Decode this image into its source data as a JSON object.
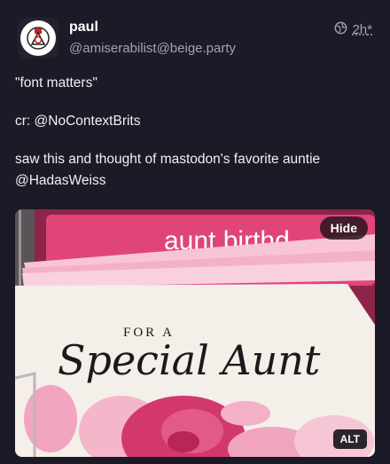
{
  "post": {
    "author": {
      "display_name": "paul",
      "handle": "@amiserabilist@beige.party"
    },
    "visibility_icon": "globe-icon",
    "time": "2h",
    "time_marker": "*",
    "content": [
      "\"font matters\"",
      "cr: @NoContextBrits",
      "saw this and thought of mastodon's favorite auntie @HadasWeiss"
    ],
    "media": {
      "hide_label": "Hide",
      "alt_label": "ALT",
      "image_text": {
        "sign_top": "aunt birthd",
        "card_small": "FOR A",
        "card_script": "Special Aunt"
      }
    }
  },
  "colors": {
    "background": "#1b1a26",
    "muted_text": "#a3a2b8",
    "card_pink": "#e0457a",
    "card_cream": "#f4efe9"
  }
}
